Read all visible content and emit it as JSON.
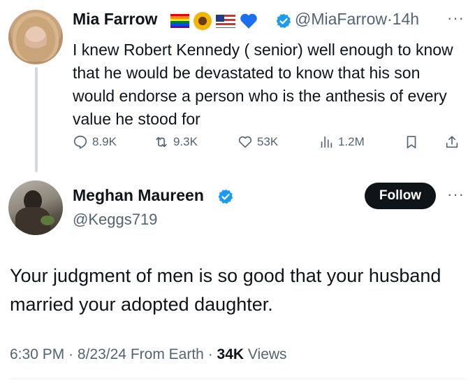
{
  "parent_tweet": {
    "author_name": "Mia Farrow",
    "emoji_icons": [
      "rainbow-flag-icon",
      "sunflower-icon",
      "us-flag-icon",
      "blue-heart-icon"
    ],
    "handle": "@MiaFarrow",
    "separator": "·",
    "time_ago": "14h",
    "text": "I knew Robert Kennedy ( senior) well enough to know that he would be devastated to know that his son would endorse a person who is the anthesis of every value he stood for",
    "stats": {
      "replies": "8.9K",
      "reposts": "9.3K",
      "likes": "53K",
      "views": "1.2M"
    }
  },
  "reply_tweet": {
    "author_name": "Meghan Maureen",
    "handle": "@Keggs719",
    "follow_label": "Follow",
    "text": "Your judgment of men is so good that your husband married your adopted daughter.",
    "meta": {
      "time": "6:30 PM",
      "separator": "·",
      "date": "8/23/24",
      "source": "From Earth",
      "views_count": "34K",
      "views_label": "Views"
    }
  },
  "colors": {
    "text_primary": "#0f1419",
    "text_secondary": "#536471",
    "verified_blue": "#1d9bf0",
    "follow_button_bg": "#0f1419",
    "thread_line": "#cfd9de"
  }
}
